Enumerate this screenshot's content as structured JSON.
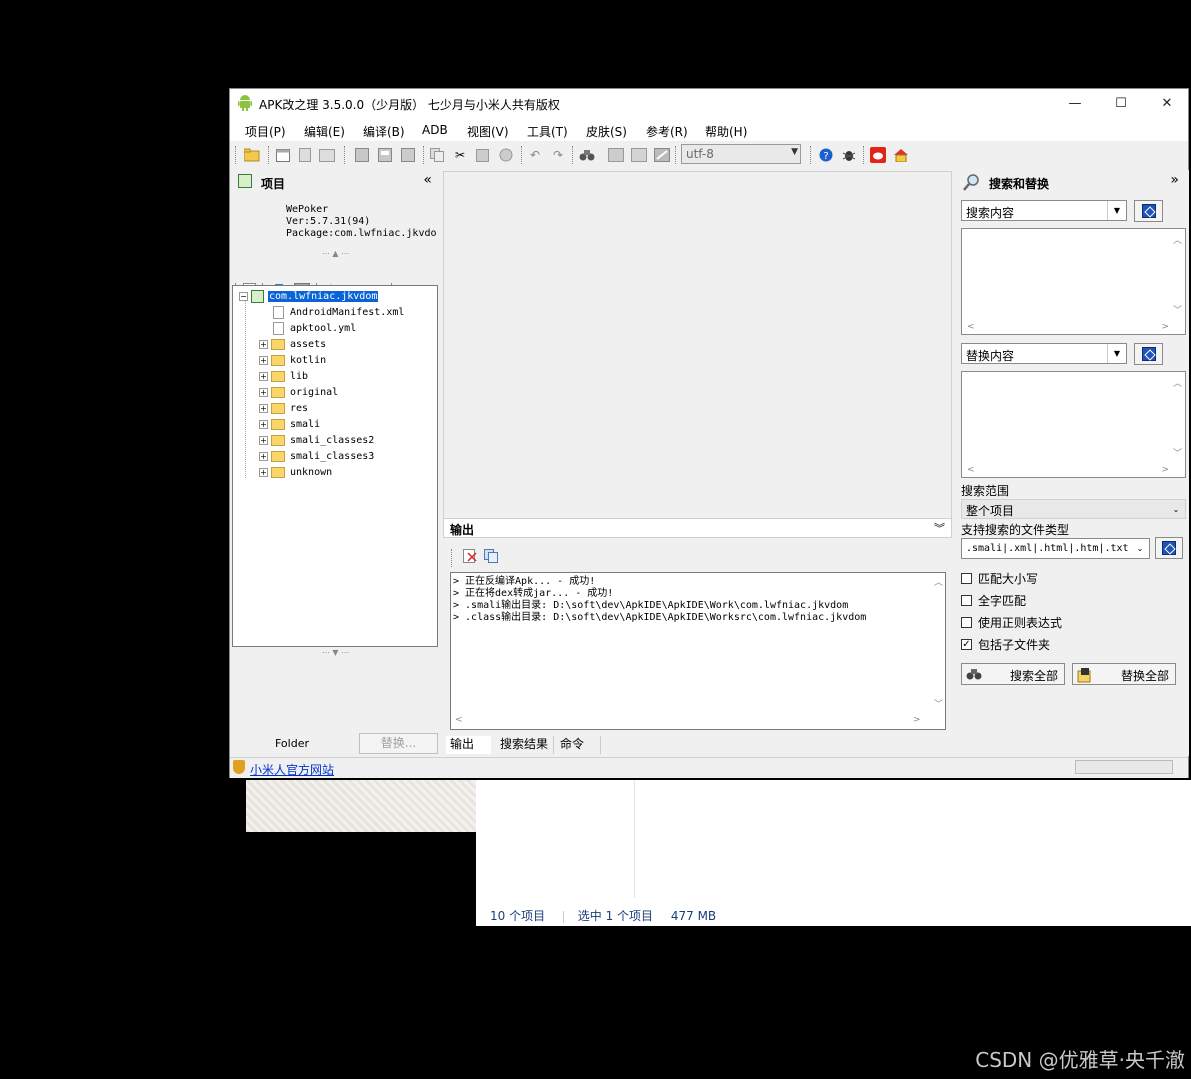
{
  "window": {
    "title": "APK改之理 3.5.0.0（少月版） 七少月与小米人共有版权",
    "minimize": "—",
    "maximize": "☐",
    "close": "✕"
  },
  "menu": [
    "项目(P)",
    "编辑(E)",
    "编译(B)",
    "ADB",
    "视图(V)",
    "工具(T)",
    "皮肤(S)",
    "参考(R)",
    "帮助(H)"
  ],
  "toolbar": {
    "encoding": "utf-8"
  },
  "project": {
    "title": "项目",
    "collapse": "«",
    "app_name": "WePoker",
    "version": "Ver:5.7.31(94)",
    "package": "Package:com.lwfniac.jkvdom",
    "root": "com.lwfniac.jkvdom",
    "files": [
      "AndroidManifest.xml",
      "apktool.yml"
    ],
    "folders": [
      "assets",
      "kotlin",
      "lib",
      "original",
      "res",
      "smali",
      "smali_classes2",
      "smali_classes3",
      "unknown"
    ],
    "folder_label": "Folder",
    "replace_button": "替换..."
  },
  "output": {
    "title": "输出",
    "lines": [
      "> 正在反编译Apk... - 成功!",
      "> 正在将dex转成jar... - 成功!",
      "> .smali输出目录: D:\\soft\\dev\\ApkIDE\\ApkIDE\\Work\\com.lwfniac.jkvdom",
      "> .class输出目录: D:\\soft\\dev\\ApkIDE\\ApkIDE\\Worksrc\\com.lwfniac.jkvdom"
    ],
    "tabs": [
      "输出",
      "搜索结果",
      "命令"
    ]
  },
  "search": {
    "title": "搜索和替换",
    "expand": "»",
    "search_combo": "搜索内容",
    "replace_combo": "替换内容",
    "scope_label": "搜索范围",
    "scope_value": "整个项目",
    "filetypes_label": "支持搜索的文件类型",
    "filetypes_value": ".smali|.xml|.html|.htm|.txt",
    "options": [
      {
        "label": "匹配大小写",
        "checked": false
      },
      {
        "label": "全字匹配",
        "checked": false
      },
      {
        "label": "使用正则表达式",
        "checked": false
      },
      {
        "label": "包括子文件夹",
        "checked": true
      }
    ],
    "search_all": "搜索全部",
    "replace_all": "替换全部"
  },
  "status": {
    "link": "小米人官方网站"
  },
  "background": {
    "item_count": "10 个项目",
    "selected": "选中 1 个项目",
    "size": "477 MB",
    "watermark": "CSDN @优雅草·央千澈"
  }
}
